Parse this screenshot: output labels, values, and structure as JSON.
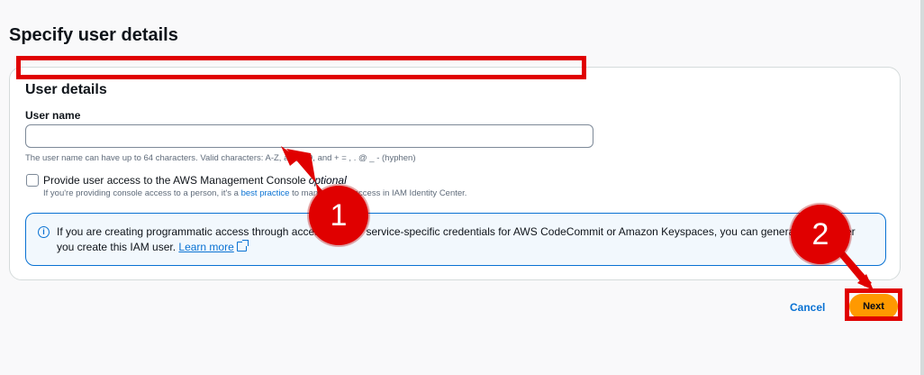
{
  "page": {
    "title": "Specify user details"
  },
  "panel": {
    "title": "User details",
    "user_name_label": "User name",
    "user_name_value": "",
    "user_name_hint": "The user name can have up to 64 characters. Valid characters: A-Z, a-z, 0-9, and + = , . @ _ - (hyphen)",
    "console_checkbox_label": "Provide user access to the AWS Management Console",
    "console_checkbox_optional": "optional",
    "console_checkbox_checked": false,
    "console_desc_prefix": "If you're providing console access to a person, it's a",
    "console_desc_link": "best practice",
    "console_desc_suffix": "to manage their access in IAM Identity Center."
  },
  "alert": {
    "text": "If you are creating programmatic access through access keys or service-specific credentials for AWS CodeCommit or Amazon Keyspaces, you can generate them after you create this IAM user.",
    "link": "Learn more"
  },
  "actions": {
    "cancel_label": "Cancel",
    "next_label": "Next"
  },
  "annotations": {
    "badge_1": "1",
    "badge_2": "2"
  },
  "colors": {
    "primary_button": "#ff9900",
    "link": "#0972d3",
    "annotation": "#e00000",
    "info_bg": "#f2f8fd"
  }
}
